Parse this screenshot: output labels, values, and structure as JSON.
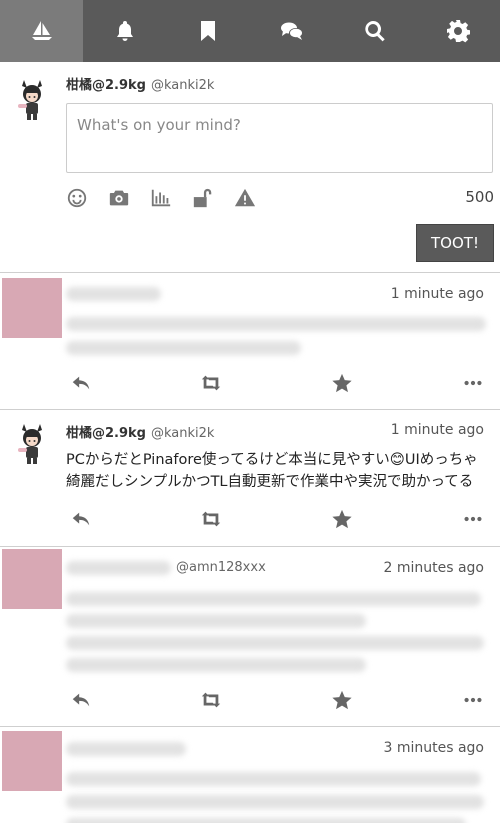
{
  "nav": {
    "items": [
      {
        "name": "home",
        "icon": "sailboat-icon"
      },
      {
        "name": "notifications",
        "icon": "bell-icon"
      },
      {
        "name": "bookmarks",
        "icon": "bookmark-icon"
      },
      {
        "name": "conversations",
        "icon": "chat-bubbles-icon"
      },
      {
        "name": "search",
        "icon": "search-icon"
      },
      {
        "name": "settings",
        "icon": "gear-icon"
      }
    ],
    "active": "home"
  },
  "compose": {
    "display_name": "柑橘@2.9kg",
    "handle": "@kanki2k",
    "placeholder": "What's on your mind?",
    "char_count": "500",
    "toot_label": "TOOT!",
    "tools": [
      "emoji-icon",
      "camera-icon",
      "poll-icon",
      "unlock-icon",
      "warning-icon"
    ]
  },
  "statuses": [
    {
      "time": "1 minute ago"
    },
    {
      "display_name": "柑橘@2.9kg",
      "handle": "@kanki2k",
      "time": "1 minute ago",
      "content": "PCからだとPinafore使ってるけど本当に見やすい😊UIめっちゃ綺麗だしシンプルかつTL自動更新で作業中や実況で助かってる"
    },
    {
      "handle": "@amn128xxx",
      "time": "2 minutes ago"
    },
    {
      "time": "3 minutes ago"
    }
  ],
  "colors": {
    "nav_bg": "#5a5a5a",
    "nav_active": "#7b7b7b",
    "avatar_placeholder": "#d8a8b4"
  }
}
